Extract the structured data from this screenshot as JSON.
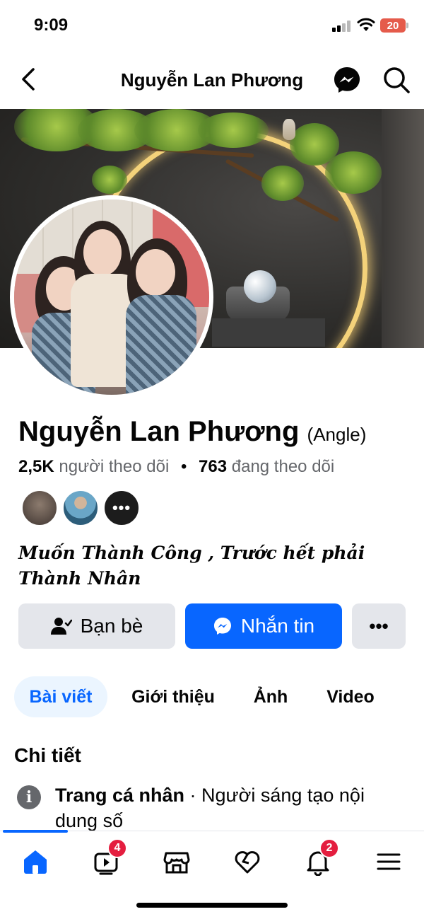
{
  "status_bar": {
    "time": "9:09",
    "battery": "20",
    "battery_color": "#e55b4b"
  },
  "header": {
    "title": "Nguyễn Lan Phương",
    "icons": [
      "chevron-left-icon",
      "messenger-icon",
      "search-icon"
    ]
  },
  "profile": {
    "name": "Nguyễn Lan Phương",
    "alt_name": "(Angle)",
    "followers_count": "2,5K",
    "followers_label": "người theo dõi",
    "separator": "•",
    "following_count": "763",
    "following_label": "đang theo dõi",
    "mutual_more": "•••",
    "bio": "Muốn Thành Công , Trước hết phải Thành Nhân"
  },
  "actions": {
    "friends_label": "Bạn bè",
    "message_label": "Nhắn tin",
    "more_label": "•••",
    "accent_color": "#0866ff"
  },
  "tabs": [
    {
      "label": "Bài viết",
      "active": true
    },
    {
      "label": "Giới thiệu",
      "active": false
    },
    {
      "label": "Ảnh",
      "active": false
    },
    {
      "label": "Video",
      "active": false
    }
  ],
  "details": {
    "title": "Chi tiết",
    "row_label": "Trang cá nhân",
    "row_value": " · Người sáng tạo nội dung số"
  },
  "bottom_nav": {
    "items": [
      {
        "icon": "home-icon",
        "badge": ""
      },
      {
        "icon": "video-icon",
        "badge": "4"
      },
      {
        "icon": "marketplace-icon",
        "badge": ""
      },
      {
        "icon": "dating-heart-icon",
        "badge": ""
      },
      {
        "icon": "bell-icon",
        "badge": "2"
      },
      {
        "icon": "menu-icon",
        "badge": ""
      }
    ],
    "badge_color": "#e41e3f"
  }
}
